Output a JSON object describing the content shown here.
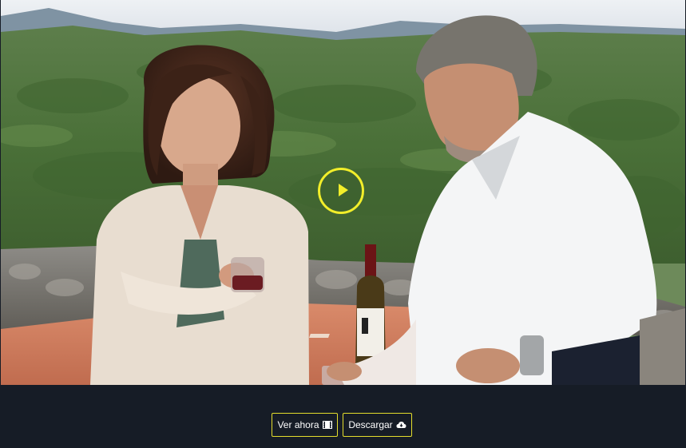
{
  "player": {
    "play_icon": "play-icon",
    "accent_color": "#f2ee2a"
  },
  "actions": {
    "watch_label": "Ver ahora",
    "watch_icon": "film-icon",
    "download_label": "Descargar",
    "download_icon": "cloud-download-icon",
    "border_color": "#e4dd2c"
  },
  "colors": {
    "background": "#161c26",
    "button_text": "#ffffff"
  }
}
